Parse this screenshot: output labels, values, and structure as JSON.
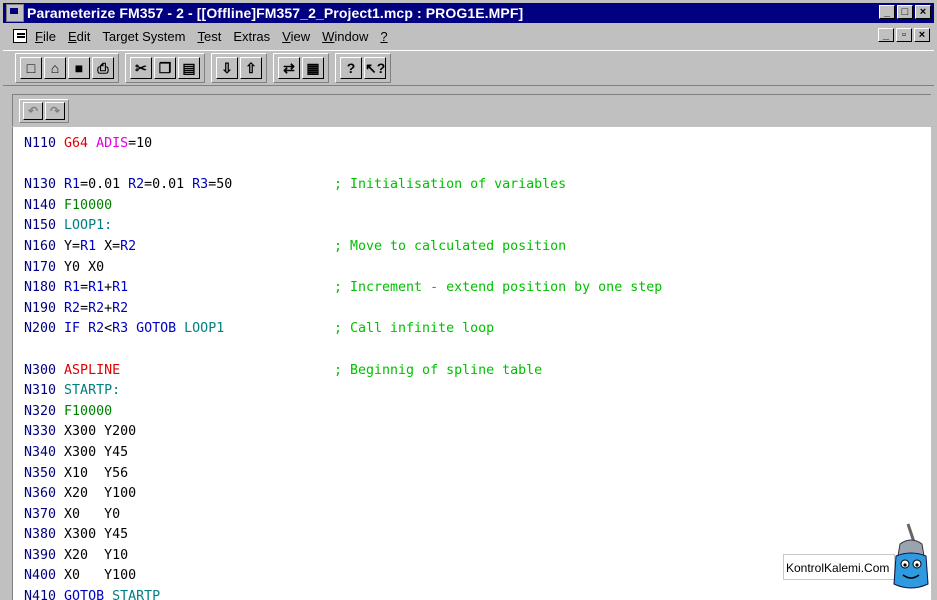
{
  "window": {
    "title": "Parameterize FM357 - 2 - [[Offline]FM357_2_Project1.mcp : PROG1E.MPF]",
    "controls": [
      "_",
      "□",
      "×"
    ]
  },
  "menubar": {
    "items": [
      {
        "label": "File",
        "key": "F",
        "rest": "ile"
      },
      {
        "label": "Edit",
        "key": "E",
        "rest": "dit"
      },
      {
        "label": "Target System",
        "key": "",
        "rest": "Target System"
      },
      {
        "label": "Test",
        "key": "T",
        "rest": "est"
      },
      {
        "label": "Extras",
        "key": "",
        "rest": "Extras"
      },
      {
        "label": "View",
        "key": "V",
        "rest": "iew"
      },
      {
        "label": "Window",
        "key": "W",
        "rest": "indow"
      },
      {
        "label": "?",
        "key": "?",
        "rest": ""
      }
    ],
    "mdi_controls": [
      "_",
      "▫",
      "×"
    ]
  },
  "toolbar": {
    "groups": [
      [
        {
          "icon": "new-file-icon",
          "glyph": "□"
        },
        {
          "icon": "open-folder-icon",
          "glyph": "⌂"
        },
        {
          "icon": "save-icon",
          "glyph": "■"
        },
        {
          "icon": "print-icon",
          "glyph": "⎙"
        }
      ],
      [
        {
          "icon": "cut-icon",
          "glyph": "✂"
        },
        {
          "icon": "copy-icon",
          "glyph": "❐"
        },
        {
          "icon": "paste-icon",
          "glyph": "▤"
        }
      ],
      [
        {
          "icon": "download-icon",
          "glyph": "⇩"
        },
        {
          "icon": "upload-icon",
          "glyph": "⇧"
        }
      ],
      [
        {
          "icon": "compare-icon",
          "glyph": "⇄"
        },
        {
          "icon": "table-icon",
          "glyph": "▦"
        }
      ],
      [
        {
          "icon": "help-icon",
          "glyph": "?"
        },
        {
          "icon": "context-help-icon",
          "glyph": "↖?"
        }
      ]
    ]
  },
  "subtoolbar": {
    "buttons": [
      {
        "icon": "undo-icon",
        "glyph": "↶"
      },
      {
        "icon": "redo-icon",
        "glyph": "↷"
      }
    ]
  },
  "code": {
    "lines": [
      {
        "n": "N110",
        "tokens": [
          {
            "t": "G64",
            "c": "c-red"
          },
          {
            "t": " "
          },
          {
            "t": "ADIS",
            "c": "c-mag"
          },
          {
            "t": "=10",
            "c": "c-black"
          }
        ],
        "comment": ""
      },
      {
        "n": "",
        "tokens": [],
        "comment": ""
      },
      {
        "n": "N130",
        "tokens": [
          {
            "t": "R1",
            "c": "c-blue"
          },
          {
            "t": "=0.01 ",
            "c": "c-black"
          },
          {
            "t": "R2",
            "c": "c-blue"
          },
          {
            "t": "=0.01 ",
            "c": "c-black"
          },
          {
            "t": "R3",
            "c": "c-blue"
          },
          {
            "t": "=50",
            "c": "c-black"
          }
        ],
        "comment": "; Initialisation of variables"
      },
      {
        "n": "N140",
        "tokens": [
          {
            "t": "F10000",
            "c": "c-green"
          }
        ],
        "comment": ""
      },
      {
        "n": "N150",
        "tokens": [
          {
            "t": "LOOP1:",
            "c": "c-teal"
          }
        ],
        "comment": ""
      },
      {
        "n": "N160",
        "tokens": [
          {
            "t": "Y=",
            "c": "c-black"
          },
          {
            "t": "R1",
            "c": "c-blue"
          },
          {
            "t": " X=",
            "c": "c-black"
          },
          {
            "t": "R2",
            "c": "c-blue"
          }
        ],
        "comment": "; Move to calculated position"
      },
      {
        "n": "N170",
        "tokens": [
          {
            "t": "Y0 X0",
            "c": "c-black"
          }
        ],
        "comment": ""
      },
      {
        "n": "N180",
        "tokens": [
          {
            "t": "R1",
            "c": "c-blue"
          },
          {
            "t": "=",
            "c": "c-black"
          },
          {
            "t": "R1",
            "c": "c-blue"
          },
          {
            "t": "+",
            "c": "c-black"
          },
          {
            "t": "R1",
            "c": "c-blue"
          }
        ],
        "comment": "; Increment - extend position by one step"
      },
      {
        "n": "N190",
        "tokens": [
          {
            "t": "R2",
            "c": "c-blue"
          },
          {
            "t": "=",
            "c": "c-black"
          },
          {
            "t": "R2",
            "c": "c-blue"
          },
          {
            "t": "+",
            "c": "c-black"
          },
          {
            "t": "R2",
            "c": "c-blue"
          }
        ],
        "comment": ""
      },
      {
        "n": "N200",
        "tokens": [
          {
            "t": "IF ",
            "c": "c-blue"
          },
          {
            "t": "R2",
            "c": "c-blue"
          },
          {
            "t": "<",
            "c": "c-black"
          },
          {
            "t": "R3",
            "c": "c-blue"
          },
          {
            "t": " GOTOB ",
            "c": "c-blue"
          },
          {
            "t": "LOOP1",
            "c": "c-teal"
          }
        ],
        "comment": "; Call infinite loop"
      },
      {
        "n": "",
        "tokens": [],
        "comment": ""
      },
      {
        "n": "N300",
        "tokens": [
          {
            "t": "ASPLINE",
            "c": "c-red"
          }
        ],
        "comment": "; Beginnig of spline table"
      },
      {
        "n": "N310",
        "tokens": [
          {
            "t": "STARTP:",
            "c": "c-teal"
          }
        ],
        "comment": ""
      },
      {
        "n": "N320",
        "tokens": [
          {
            "t": "F10000",
            "c": "c-green"
          }
        ],
        "comment": ""
      },
      {
        "n": "N330",
        "tokens": [
          {
            "t": "X300 Y200",
            "c": "c-black"
          }
        ],
        "comment": ""
      },
      {
        "n": "N340",
        "tokens": [
          {
            "t": "X300 Y45",
            "c": "c-black"
          }
        ],
        "comment": ""
      },
      {
        "n": "N350",
        "tokens": [
          {
            "t": "X10  Y56",
            "c": "c-black"
          }
        ],
        "comment": ""
      },
      {
        "n": "N360",
        "tokens": [
          {
            "t": "X20  Y100",
            "c": "c-black"
          }
        ],
        "comment": ""
      },
      {
        "n": "N370",
        "tokens": [
          {
            "t": "X0   Y0",
            "c": "c-black"
          }
        ],
        "comment": ""
      },
      {
        "n": "N380",
        "tokens": [
          {
            "t": "X300 Y45",
            "c": "c-black"
          }
        ],
        "comment": ""
      },
      {
        "n": "N390",
        "tokens": [
          {
            "t": "X20  Y10",
            "c": "c-black"
          }
        ],
        "comment": ""
      },
      {
        "n": "N400",
        "tokens": [
          {
            "t": "X0   Y100",
            "c": "c-black"
          }
        ],
        "comment": ""
      },
      {
        "n": "N410",
        "tokens": [
          {
            "t": "GOTOB ",
            "c": "c-blue"
          },
          {
            "t": "STARTP",
            "c": "c-teal"
          }
        ],
        "comment": ""
      }
    ]
  },
  "watermark": {
    "text": "KontrolKalemi.Com"
  },
  "colors": {
    "titlebar": "#000080",
    "face": "#c0c0c0",
    "comment": "#00c000",
    "line_number": "#000080",
    "keyword_red": "#e00000",
    "keyword_magenta": "#e000e0",
    "variable_blue": "#0000c0",
    "label_teal": "#008080",
    "feed_green": "#008000"
  }
}
